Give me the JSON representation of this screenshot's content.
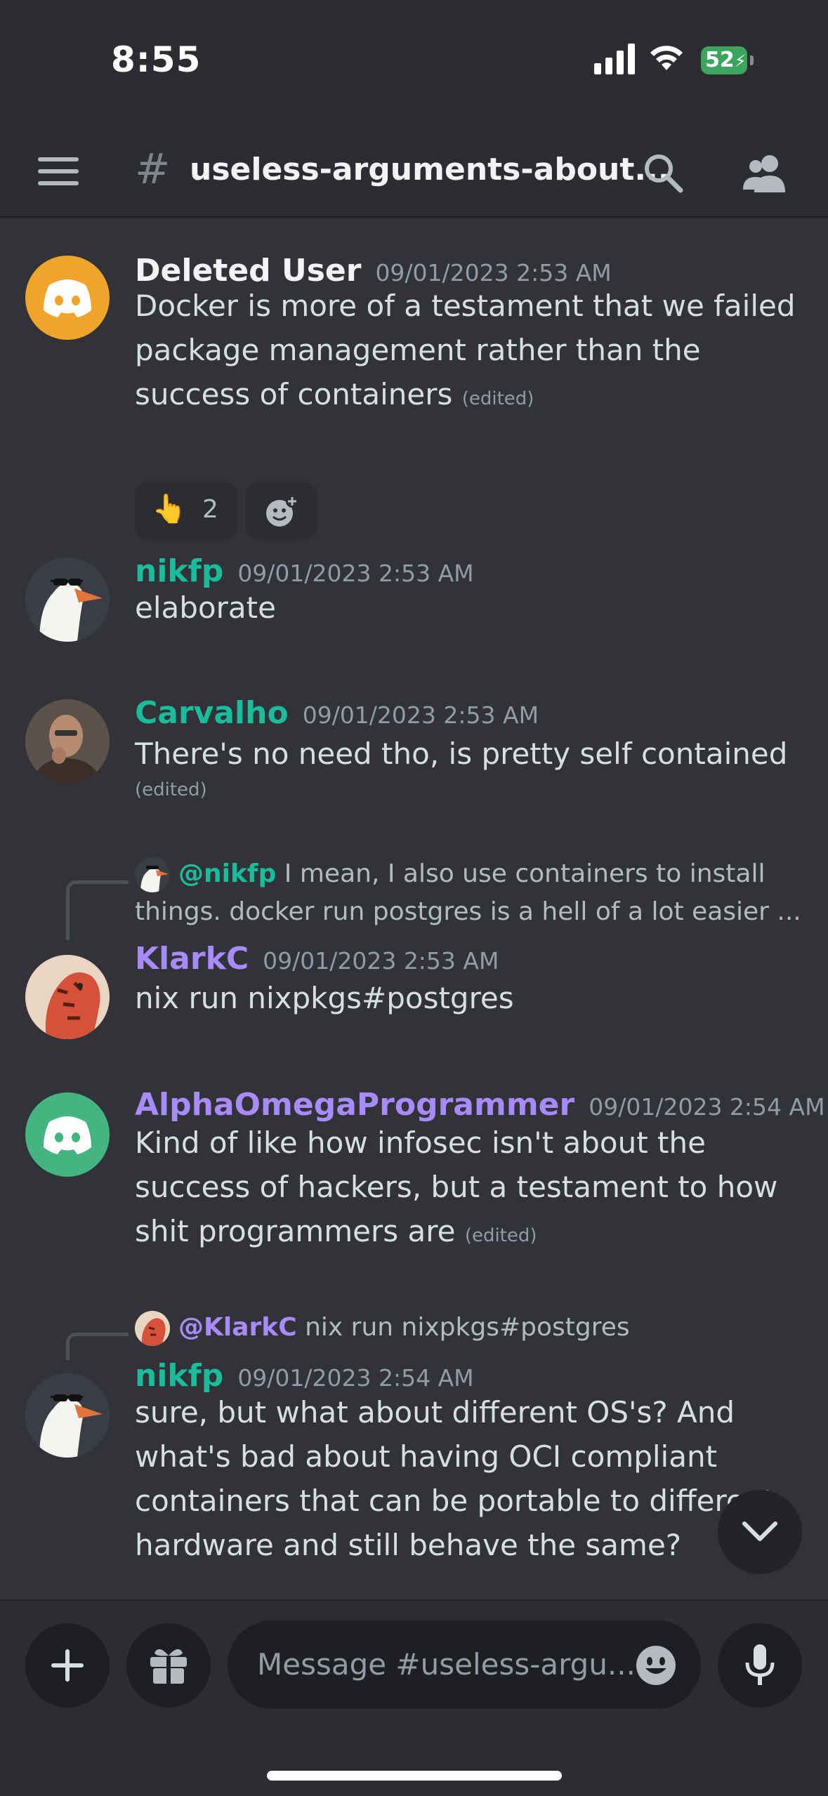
{
  "status": {
    "time": "8:55",
    "battery": "52"
  },
  "header": {
    "channel_name": "useless-arguments-about...",
    "hash": "#"
  },
  "messages": [
    {
      "username": "Deleted User",
      "timestamp": "09/01/2023 2:53 AM",
      "text": "Docker is more of a testament that we failed package management rather than the success of containers",
      "edited": "(edited)",
      "name_color": "#f2f3f5",
      "reactions": [
        {
          "emoji": "👆",
          "count": "2"
        }
      ]
    },
    {
      "username": "nikfp",
      "timestamp": "09/01/2023 2:53 AM",
      "text": "elaborate",
      "name_color": "#1abc9c"
    },
    {
      "username": "Carvalho",
      "timestamp": "09/01/2023 2:53 AM",
      "text": "There's no need tho, is pretty self contained",
      "edited": "(edited)",
      "name_color": "#1abc9c"
    },
    {
      "reply": {
        "mention": "@nikfp",
        "text": "I mean, I also use containers to install things. docker run postgres is a hell of a lot easier ..."
      },
      "username": "KlarkC",
      "timestamp": "09/01/2023 2:53 AM",
      "text": "nix run nixpkgs#postgres",
      "name_color": "#a78bfa"
    },
    {
      "username": "AlphaOmegaProgrammer",
      "timestamp": "09/01/2023 2:54 AM",
      "text": "Kind of like how infosec isn't about the success of hackers, but a testament to how shit programmers are",
      "edited": "(edited)",
      "name_color": "#a78bfa"
    },
    {
      "reply": {
        "mention": "@KlarkC",
        "text": "nix run nixpkgs#postgres"
      },
      "username": "nikfp",
      "timestamp": "09/01/2023 2:54 AM",
      "text": "sure, but what about different OS's? And what's bad about having OCI compliant containers that can be portable to different hardware and still behave the same?",
      "name_color": "#1abc9c"
    }
  ],
  "composer": {
    "placeholder": "Message #useless-argu..."
  },
  "colors": {
    "background": "#313338",
    "bar": "#2b2d31",
    "input": "#1e1f22",
    "teal": "#1abc9c",
    "purple": "#a78bfa",
    "discord_orange": "#f0a52a",
    "discord_green": "#43b581"
  }
}
